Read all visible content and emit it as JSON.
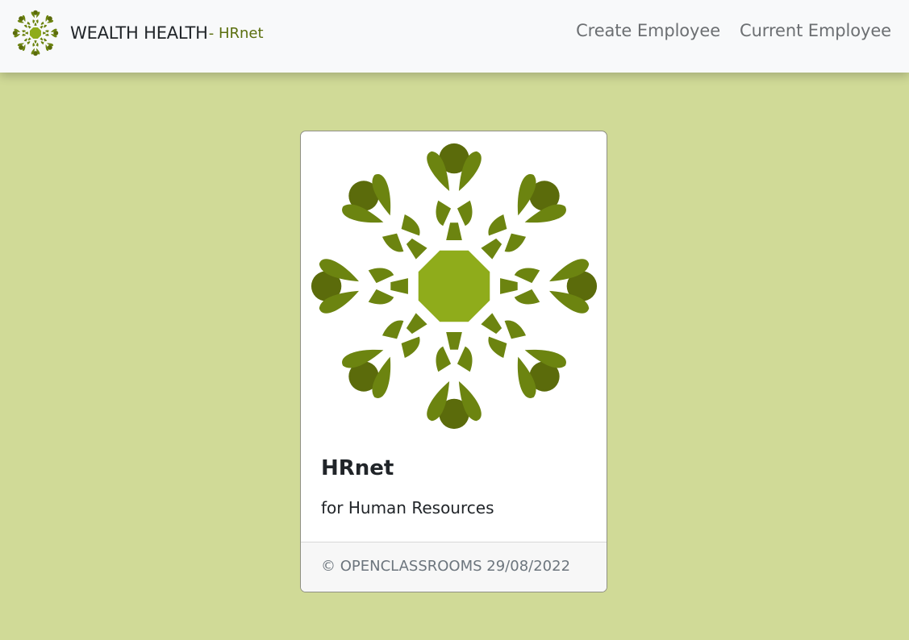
{
  "navbar": {
    "brand_name": "WEALTH HEALTH",
    "brand_sub": "- HRnet",
    "links": [
      {
        "label": "Create Employee"
      },
      {
        "label": "Current Employee"
      }
    ]
  },
  "card": {
    "title": "HRnet",
    "text": "for Human Resources",
    "footer": "© OPENCLASSROOMS 29/08/2022"
  },
  "icons": {
    "brand_logo": "wealth-health-flower-logo",
    "card_image": "wealth-health-flower-logo"
  },
  "colors": {
    "background": "#d0da97",
    "navbar": "#f8f9fa",
    "logo_dark": "#5b6b0b",
    "logo_mid": "#6c8410",
    "logo_center": "#8fac1b",
    "brand_sub": "#5a6e0d"
  }
}
